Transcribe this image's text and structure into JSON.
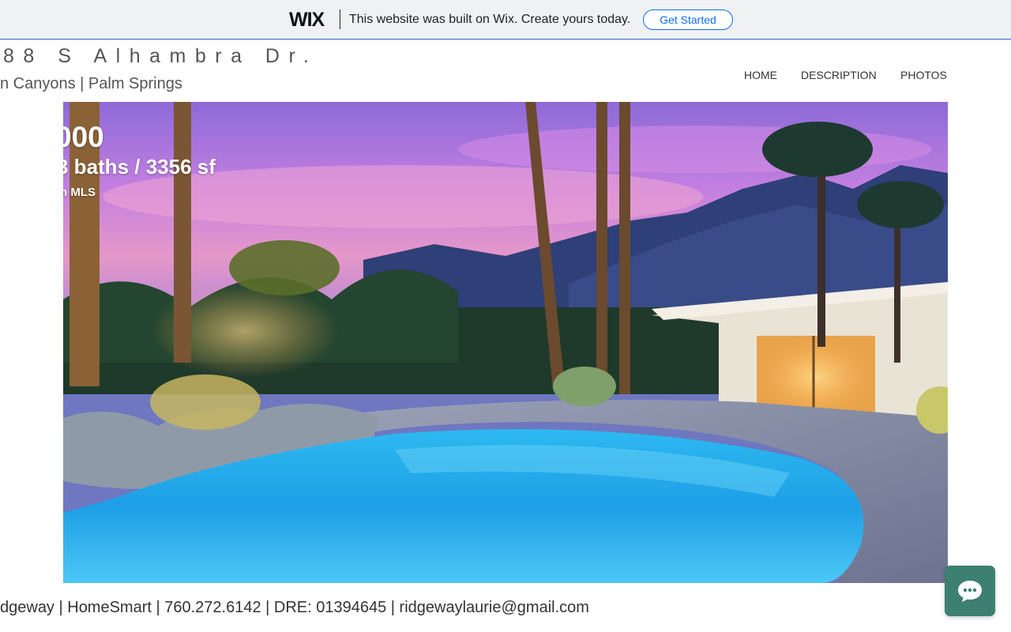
{
  "wix_banner": {
    "logo": "WIX",
    "message": "This website was built on Wix. Create yours today.",
    "cta_label": "Get Started",
    "accent": "#116dff"
  },
  "header": {
    "title": "88 S Alhambra Dr.",
    "subtitle": "n Canyons |  Palm Springs",
    "nav": [
      "HOME",
      "DESCRIPTION",
      "PHOTOS"
    ]
  },
  "hero": {
    "price": "000",
    "specs": "3 baths / 3356 sf",
    "mls": "n MLS",
    "image": "evening pool, palms and mountains"
  },
  "footer": {
    "contact_line": "dgeway  |  HomeSmart  |  760.272.6142  |  DRE: 01394645  |  ridgewaylaurie@gmail.com"
  },
  "chat": {
    "icon": "chat-bubble-icon",
    "color": "#3d7f70"
  }
}
